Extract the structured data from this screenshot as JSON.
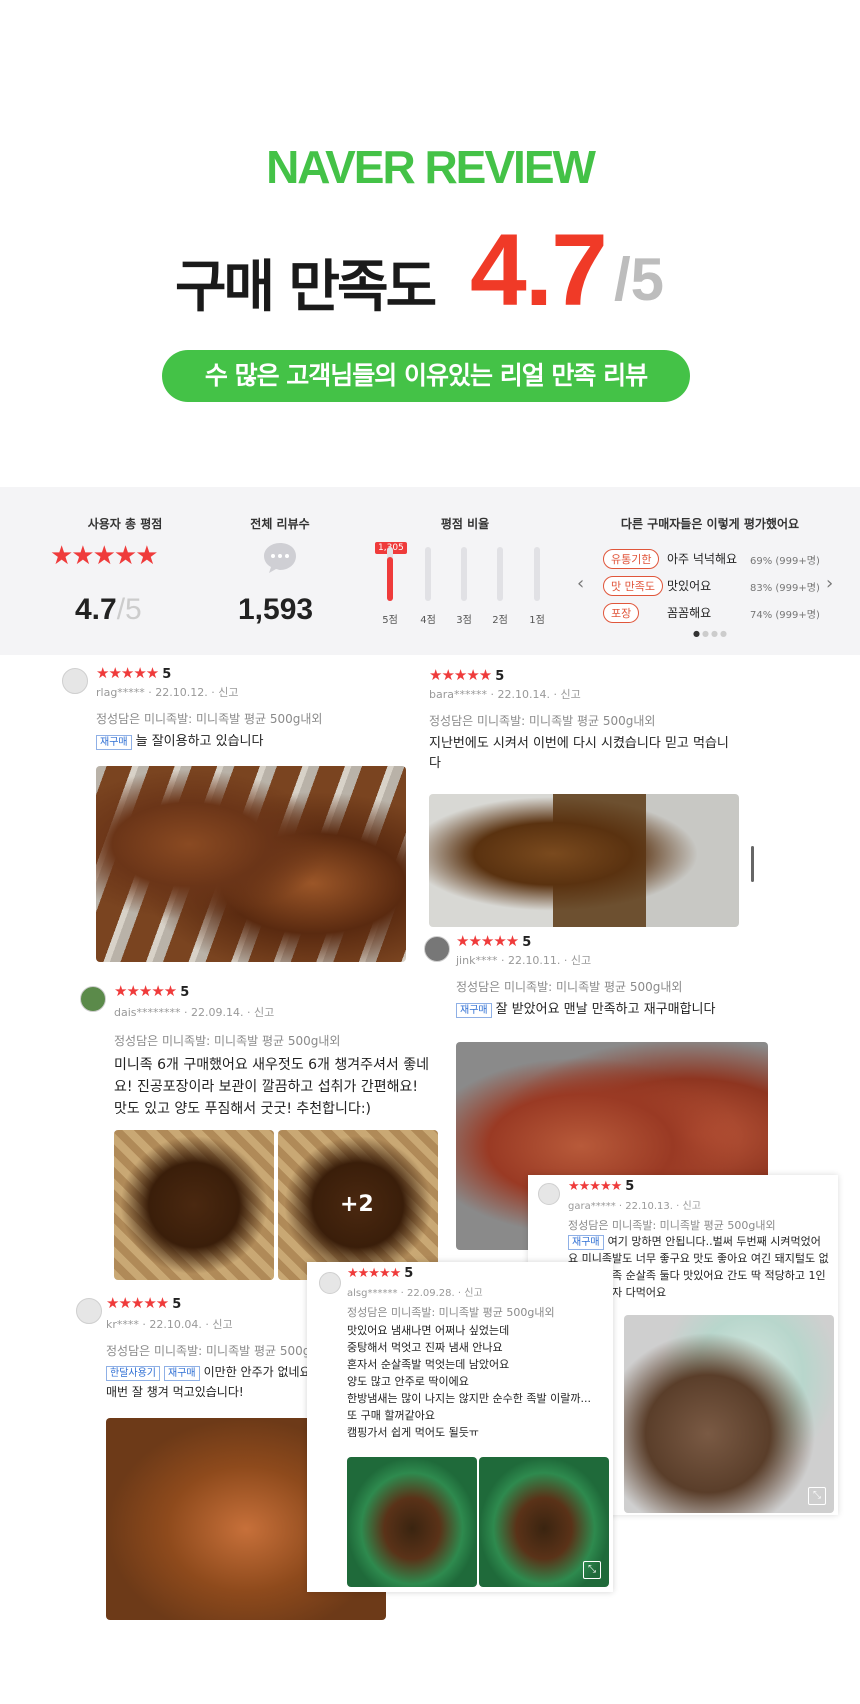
{
  "hero": {
    "brand": "NAVER REVIEW",
    "satisfaction_label": "구매 만족도",
    "score": "4.7",
    "score_max": "/5",
    "pill_text": "수 많은 고객님들의 이유있는 리얼 만족 리뷰"
  },
  "summary": {
    "user_rating_header": "사용자 총 평점",
    "user_rating_value": "4.7",
    "user_rating_max": "/5",
    "star_rating": 4.7,
    "total_reviews_header": "전체 리뷰수",
    "total_reviews_value": "1,593",
    "ratio_header": "평점 비율",
    "ratio_top_count": "1,305",
    "ratio_bars": [
      {
        "label": "5점",
        "fraction": 0.82
      },
      {
        "label": "4점",
        "fraction": 0.0
      },
      {
        "label": "3점",
        "fraction": 0.0
      },
      {
        "label": "2점",
        "fraction": 0.0
      },
      {
        "label": "1점",
        "fraction": 0.0
      }
    ],
    "others_header": "다른 구매자들은 이렇게 평가했어요",
    "evaluations": [
      {
        "tag": "유통기한",
        "text": "아주 넉넉해요",
        "pct": "69%",
        "count": "(999+명)"
      },
      {
        "tag": "맛 만족도",
        "text": "맛있어요",
        "pct": "83%",
        "count": "(999+명)"
      },
      {
        "tag": "포장",
        "text": "꼼꼼해요",
        "pct": "74%",
        "count": "(999+명)"
      }
    ],
    "accent": "#ef3b3b"
  },
  "reviews": {
    "r1": {
      "stars": "★★★★★",
      "rating": "5",
      "meta": "rlag***** · 22.10.12. · 신고",
      "option": "정성담은 미니족발: 미니족발 평균 500g내외",
      "badge": "재구매",
      "text": "늘 잘이용하고 있습니다"
    },
    "r2": {
      "stars": "★★★★★",
      "rating": "5",
      "meta": "bara****** · 22.10.14. · 신고",
      "option": "정성담은 미니족발: 미니족발 평균 500g내외",
      "text": "지난번에도 시켜서 이번에 다시 시켰습니다 믿고 먹습니다"
    },
    "r3": {
      "stars": "★★★★★",
      "rating": "5",
      "meta": "jink**** · 22.10.11. · 신고",
      "option": "정성담은 미니족발: 미니족발 평균 500g내외",
      "badge": "재구매",
      "text": "잘 받았어요 맨날 만족하고 재구매합니다"
    },
    "r4": {
      "stars": "★★★★★",
      "rating": "5",
      "meta": "dais******** · 22.09.14. · 신고",
      "option": "정성담은 미니족발: 미니족발 평균 500g내외",
      "text": "미니족 6개 구매했어요 새우젓도 6개 챙겨주셔서 좋네요! 진공포장이라 보관이 깔끔하고 섭취가 간편해요! 맛도 있고 양도 푸짐해서 굿굿! 추천합니다:)",
      "more": "+2"
    },
    "r5": {
      "stars": "★★★★★",
      "rating": "5",
      "meta": "gara***** · 22.10.13. · 신고",
      "option": "정성담은 미니족발: 미니족발 평균 500g내외",
      "badge": "재구매",
      "text": "여기 망하면 안됩니다..벌써 두번째 시켜먹었어요 미니족발도 너무 좋구요 맛도 좋아요 여긴 돼지털도 없어요 미니족 순살족 둘다 맛있어요 간도 딱 적당하고 1인분이면 혼자 다먹어요"
    },
    "r6": {
      "stars": "★★★★★",
      "rating": "5",
      "meta": "kr**** · 22.10.04. · 신고",
      "option": "정성담은 미니족발: 미니족발 평균 500g내외",
      "badge1": "한달사용기",
      "badge2": "재구매",
      "text": "이만한 안주가 없네요 보관도 쉽고 매번 잘 챙겨 먹고있습니다!"
    },
    "r7": {
      "stars": "★★★★★",
      "rating": "5",
      "meta": "alsg****** · 22.09.28. · 신고",
      "option": "정성담은 미니족발: 미니족발 평균 500g내외",
      "text": "맛있어요 냄새나면 어쩌나 싶었는데\n중탕해서 먹엇고 진짜 냄새 안나요\n혼자서 순살족발 먹엇는데 남았어요\n양도 많고 안주로 딱이에요\n한방냄새는 많이 나지는 않지만 순수한 족발 이랄까...\n또 구매 할꺼같아요\n캠핑가서 쉽게 먹어도 될듯ㅠ"
    }
  }
}
